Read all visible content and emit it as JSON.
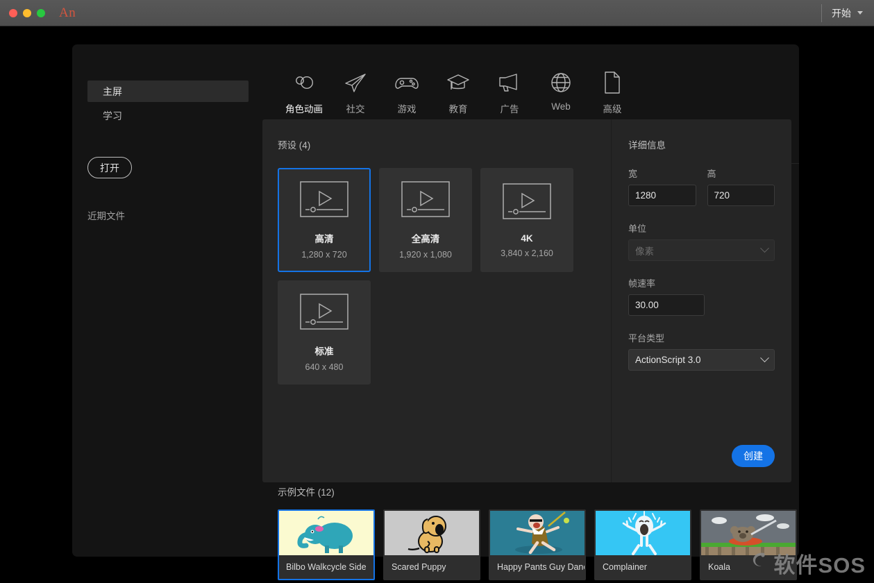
{
  "titlebar": {
    "app_abbr": "An",
    "start_label": "开始",
    "traffic_lights": [
      "close-red",
      "minimize-yellow",
      "maximize-green"
    ]
  },
  "sidebar": {
    "items": [
      {
        "label": "主屏",
        "active": true
      },
      {
        "label": "学习",
        "active": false
      }
    ],
    "open_button": "打开",
    "recent_files_label": "近期文件"
  },
  "tabs": [
    {
      "label": "角色动画",
      "icon": "character-animation-icon",
      "active": true
    },
    {
      "label": "社交",
      "icon": "paper-plane-icon",
      "active": false
    },
    {
      "label": "游戏",
      "icon": "gamepad-icon",
      "active": false
    },
    {
      "label": "教育",
      "icon": "graduation-cap-icon",
      "active": false
    },
    {
      "label": "广告",
      "icon": "megaphone-icon",
      "active": false
    },
    {
      "label": "Web",
      "icon": "globe-icon",
      "active": false
    },
    {
      "label": "高级",
      "icon": "document-page-icon",
      "active": false
    }
  ],
  "presets": {
    "section_title": "预设 (4)",
    "items": [
      {
        "name": "高清",
        "dimensions": "1,280 x 720",
        "selected": true
      },
      {
        "name": "全高清",
        "dimensions": "1,920 x 1,080",
        "selected": false
      },
      {
        "name": "4K",
        "dimensions": "3,840 x 2,160",
        "selected": false
      },
      {
        "name": "标准",
        "dimensions": "640 x 480",
        "selected": false
      }
    ]
  },
  "details": {
    "section_title": "详细信息",
    "width_label": "宽",
    "width_value": "1280",
    "height_label": "高",
    "height_value": "720",
    "unit_label": "单位",
    "unit_value": "像素",
    "framerate_label": "帧速率",
    "framerate_value": "30.00",
    "platform_label": "平台类型",
    "platform_value": "ActionScript 3.0",
    "create_button": "创建"
  },
  "samples": {
    "section_title": "示例文件 (12)",
    "next_arrow": "›",
    "items": [
      {
        "name": "Bilbo Walkcycle Side",
        "thumb": "elephant-thumb",
        "bg": "#fbfad0",
        "selected": true
      },
      {
        "name": "Scared Puppy",
        "thumb": "puppy-thumb",
        "bg": "#c9c9c9",
        "selected": false
      },
      {
        "name": "Happy Pants Guy Dance",
        "thumb": "dancer-thumb",
        "bg": "#2b7d94",
        "selected": false
      },
      {
        "name": "Complainer",
        "thumb": "complainer-thumb",
        "bg": "#35c6f4",
        "selected": false
      },
      {
        "name": "Koala",
        "thumb": "koala-thumb",
        "bg": "#62686e",
        "selected": false
      }
    ]
  },
  "watermark": {
    "text": "软件SOS"
  },
  "colors": {
    "accent": "#1473e6",
    "window_bg": "#141414",
    "panel_bg": "#252525",
    "card_bg": "#323232"
  }
}
